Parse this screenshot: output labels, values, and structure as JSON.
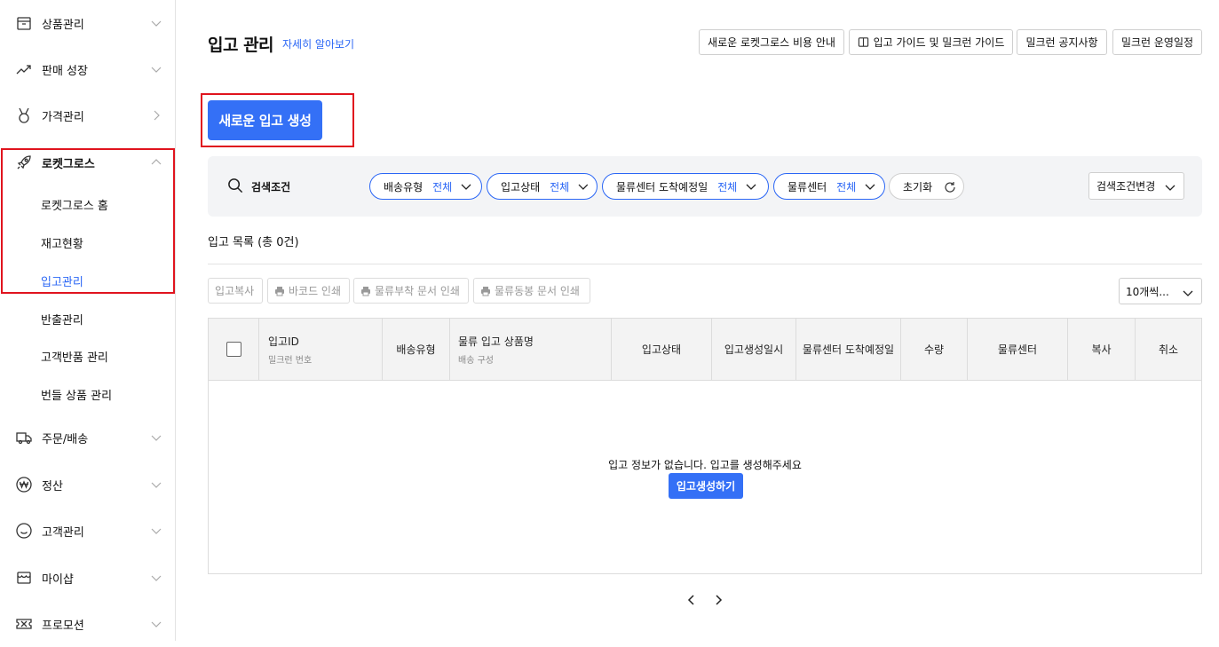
{
  "sidebar": {
    "items": [
      {
        "label": "상품관리",
        "icon": "box-icon",
        "chevron": "down"
      },
      {
        "label": "판매 성장",
        "icon": "trend-up-icon",
        "chevron": "down"
      },
      {
        "label": "가격관리",
        "icon": "medal-icon",
        "chevron": "right"
      },
      {
        "label": "로켓그로스",
        "icon": "rocket-icon",
        "chevron": "up"
      },
      {
        "label": "주문/배송",
        "icon": "truck-icon",
        "chevron": "down"
      },
      {
        "label": "정산",
        "icon": "won-icon",
        "chevron": "down"
      },
      {
        "label": "고객관리",
        "icon": "smile-icon",
        "chevron": "down"
      },
      {
        "label": "마이샵",
        "icon": "shop-icon",
        "chevron": "down"
      },
      {
        "label": "프로모션",
        "icon": "ticket-icon",
        "chevron": "down"
      }
    ],
    "sub_items": [
      {
        "label": "로켓그로스 홈"
      },
      {
        "label": "재고현황"
      },
      {
        "label": "입고관리"
      },
      {
        "label": "반출관리"
      },
      {
        "label": "고객반품 관리"
      },
      {
        "label": "번들 상품 관리"
      }
    ]
  },
  "header": {
    "title": "입고 관리",
    "learn_more": "자세히 알아보기",
    "buttons": [
      "새로운 로켓그로스 비용 안내",
      "입고 가이드 및 밀크런 가이드",
      "밀크런 공지사항",
      "밀크런 운영일정"
    ]
  },
  "new_button": "새로운 입고 생성",
  "filters": {
    "search_label": "검색조건",
    "pills": [
      {
        "key": "배송유형",
        "value": "전체"
      },
      {
        "key": "입고상태",
        "value": "전체"
      },
      {
        "key": "물류센터 도착예정일",
        "value": "전체"
      },
      {
        "key": "물류센터",
        "value": "전체"
      }
    ],
    "reset": "초기화",
    "change": "검색조건변경"
  },
  "list": {
    "title": "입고 목록 (총 0건)",
    "actions": [
      "입고복사",
      "바코드 인쇄",
      "물류부착 문서 인쇄",
      "물류동봉 문서 인쇄"
    ],
    "per_page": "10개씩..."
  },
  "table": {
    "headers": [
      {
        "main": "입고ID",
        "sub": "밀크런 번호"
      },
      {
        "main": "배송유형",
        "sub": ""
      },
      {
        "main": "물류 입고 상품명",
        "sub": "배송 구성"
      },
      {
        "main": "입고상태",
        "sub": ""
      },
      {
        "main": "입고생성일시",
        "sub": ""
      },
      {
        "main": "물류센터 도착예정일",
        "sub": ""
      },
      {
        "main": "수량",
        "sub": ""
      },
      {
        "main": "물류센터",
        "sub": ""
      },
      {
        "main": "복사",
        "sub": ""
      },
      {
        "main": "취소",
        "sub": ""
      }
    ],
    "empty_message": "입고 정보가 없습니다. 입고를 생성해주세요",
    "empty_button": "입고생성하기"
  },
  "colors": {
    "accent": "#3470f6",
    "link": "#2a66f5",
    "highlight_border": "#e0141e"
  }
}
